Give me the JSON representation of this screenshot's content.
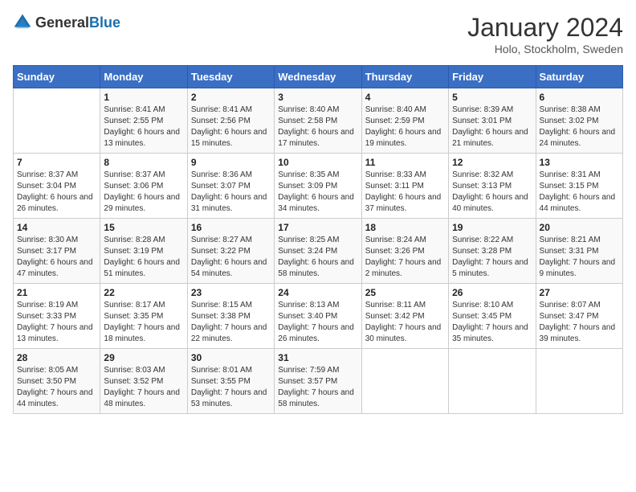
{
  "header": {
    "logo": {
      "general": "General",
      "blue": "Blue"
    },
    "title": "January 2024",
    "location": "Holo, Stockholm, Sweden"
  },
  "weekdays": [
    "Sunday",
    "Monday",
    "Tuesday",
    "Wednesday",
    "Thursday",
    "Friday",
    "Saturday"
  ],
  "weeks": [
    [
      {
        "day": "",
        "sunrise": "",
        "sunset": "",
        "daylight": ""
      },
      {
        "day": "1",
        "sunrise": "Sunrise: 8:41 AM",
        "sunset": "Sunset: 2:55 PM",
        "daylight": "Daylight: 6 hours and 13 minutes."
      },
      {
        "day": "2",
        "sunrise": "Sunrise: 8:41 AM",
        "sunset": "Sunset: 2:56 PM",
        "daylight": "Daylight: 6 hours and 15 minutes."
      },
      {
        "day": "3",
        "sunrise": "Sunrise: 8:40 AM",
        "sunset": "Sunset: 2:58 PM",
        "daylight": "Daylight: 6 hours and 17 minutes."
      },
      {
        "day": "4",
        "sunrise": "Sunrise: 8:40 AM",
        "sunset": "Sunset: 2:59 PM",
        "daylight": "Daylight: 6 hours and 19 minutes."
      },
      {
        "day": "5",
        "sunrise": "Sunrise: 8:39 AM",
        "sunset": "Sunset: 3:01 PM",
        "daylight": "Daylight: 6 hours and 21 minutes."
      },
      {
        "day": "6",
        "sunrise": "Sunrise: 8:38 AM",
        "sunset": "Sunset: 3:02 PM",
        "daylight": "Daylight: 6 hours and 24 minutes."
      }
    ],
    [
      {
        "day": "7",
        "sunrise": "Sunrise: 8:37 AM",
        "sunset": "Sunset: 3:04 PM",
        "daylight": "Daylight: 6 hours and 26 minutes."
      },
      {
        "day": "8",
        "sunrise": "Sunrise: 8:37 AM",
        "sunset": "Sunset: 3:06 PM",
        "daylight": "Daylight: 6 hours and 29 minutes."
      },
      {
        "day": "9",
        "sunrise": "Sunrise: 8:36 AM",
        "sunset": "Sunset: 3:07 PM",
        "daylight": "Daylight: 6 hours and 31 minutes."
      },
      {
        "day": "10",
        "sunrise": "Sunrise: 8:35 AM",
        "sunset": "Sunset: 3:09 PM",
        "daylight": "Daylight: 6 hours and 34 minutes."
      },
      {
        "day": "11",
        "sunrise": "Sunrise: 8:33 AM",
        "sunset": "Sunset: 3:11 PM",
        "daylight": "Daylight: 6 hours and 37 minutes."
      },
      {
        "day": "12",
        "sunrise": "Sunrise: 8:32 AM",
        "sunset": "Sunset: 3:13 PM",
        "daylight": "Daylight: 6 hours and 40 minutes."
      },
      {
        "day": "13",
        "sunrise": "Sunrise: 8:31 AM",
        "sunset": "Sunset: 3:15 PM",
        "daylight": "Daylight: 6 hours and 44 minutes."
      }
    ],
    [
      {
        "day": "14",
        "sunrise": "Sunrise: 8:30 AM",
        "sunset": "Sunset: 3:17 PM",
        "daylight": "Daylight: 6 hours and 47 minutes."
      },
      {
        "day": "15",
        "sunrise": "Sunrise: 8:28 AM",
        "sunset": "Sunset: 3:19 PM",
        "daylight": "Daylight: 6 hours and 51 minutes."
      },
      {
        "day": "16",
        "sunrise": "Sunrise: 8:27 AM",
        "sunset": "Sunset: 3:22 PM",
        "daylight": "Daylight: 6 hours and 54 minutes."
      },
      {
        "day": "17",
        "sunrise": "Sunrise: 8:25 AM",
        "sunset": "Sunset: 3:24 PM",
        "daylight": "Daylight: 6 hours and 58 minutes."
      },
      {
        "day": "18",
        "sunrise": "Sunrise: 8:24 AM",
        "sunset": "Sunset: 3:26 PM",
        "daylight": "Daylight: 7 hours and 2 minutes."
      },
      {
        "day": "19",
        "sunrise": "Sunrise: 8:22 AM",
        "sunset": "Sunset: 3:28 PM",
        "daylight": "Daylight: 7 hours and 5 minutes."
      },
      {
        "day": "20",
        "sunrise": "Sunrise: 8:21 AM",
        "sunset": "Sunset: 3:31 PM",
        "daylight": "Daylight: 7 hours and 9 minutes."
      }
    ],
    [
      {
        "day": "21",
        "sunrise": "Sunrise: 8:19 AM",
        "sunset": "Sunset: 3:33 PM",
        "daylight": "Daylight: 7 hours and 13 minutes."
      },
      {
        "day": "22",
        "sunrise": "Sunrise: 8:17 AM",
        "sunset": "Sunset: 3:35 PM",
        "daylight": "Daylight: 7 hours and 18 minutes."
      },
      {
        "day": "23",
        "sunrise": "Sunrise: 8:15 AM",
        "sunset": "Sunset: 3:38 PM",
        "daylight": "Daylight: 7 hours and 22 minutes."
      },
      {
        "day": "24",
        "sunrise": "Sunrise: 8:13 AM",
        "sunset": "Sunset: 3:40 PM",
        "daylight": "Daylight: 7 hours and 26 minutes."
      },
      {
        "day": "25",
        "sunrise": "Sunrise: 8:11 AM",
        "sunset": "Sunset: 3:42 PM",
        "daylight": "Daylight: 7 hours and 30 minutes."
      },
      {
        "day": "26",
        "sunrise": "Sunrise: 8:10 AM",
        "sunset": "Sunset: 3:45 PM",
        "daylight": "Daylight: 7 hours and 35 minutes."
      },
      {
        "day": "27",
        "sunrise": "Sunrise: 8:07 AM",
        "sunset": "Sunset: 3:47 PM",
        "daylight": "Daylight: 7 hours and 39 minutes."
      }
    ],
    [
      {
        "day": "28",
        "sunrise": "Sunrise: 8:05 AM",
        "sunset": "Sunset: 3:50 PM",
        "daylight": "Daylight: 7 hours and 44 minutes."
      },
      {
        "day": "29",
        "sunrise": "Sunrise: 8:03 AM",
        "sunset": "Sunset: 3:52 PM",
        "daylight": "Daylight: 7 hours and 48 minutes."
      },
      {
        "day": "30",
        "sunrise": "Sunrise: 8:01 AM",
        "sunset": "Sunset: 3:55 PM",
        "daylight": "Daylight: 7 hours and 53 minutes."
      },
      {
        "day": "31",
        "sunrise": "Sunrise: 7:59 AM",
        "sunset": "Sunset: 3:57 PM",
        "daylight": "Daylight: 7 hours and 58 minutes."
      },
      {
        "day": "",
        "sunrise": "",
        "sunset": "",
        "daylight": ""
      },
      {
        "day": "",
        "sunrise": "",
        "sunset": "",
        "daylight": ""
      },
      {
        "day": "",
        "sunrise": "",
        "sunset": "",
        "daylight": ""
      }
    ]
  ]
}
